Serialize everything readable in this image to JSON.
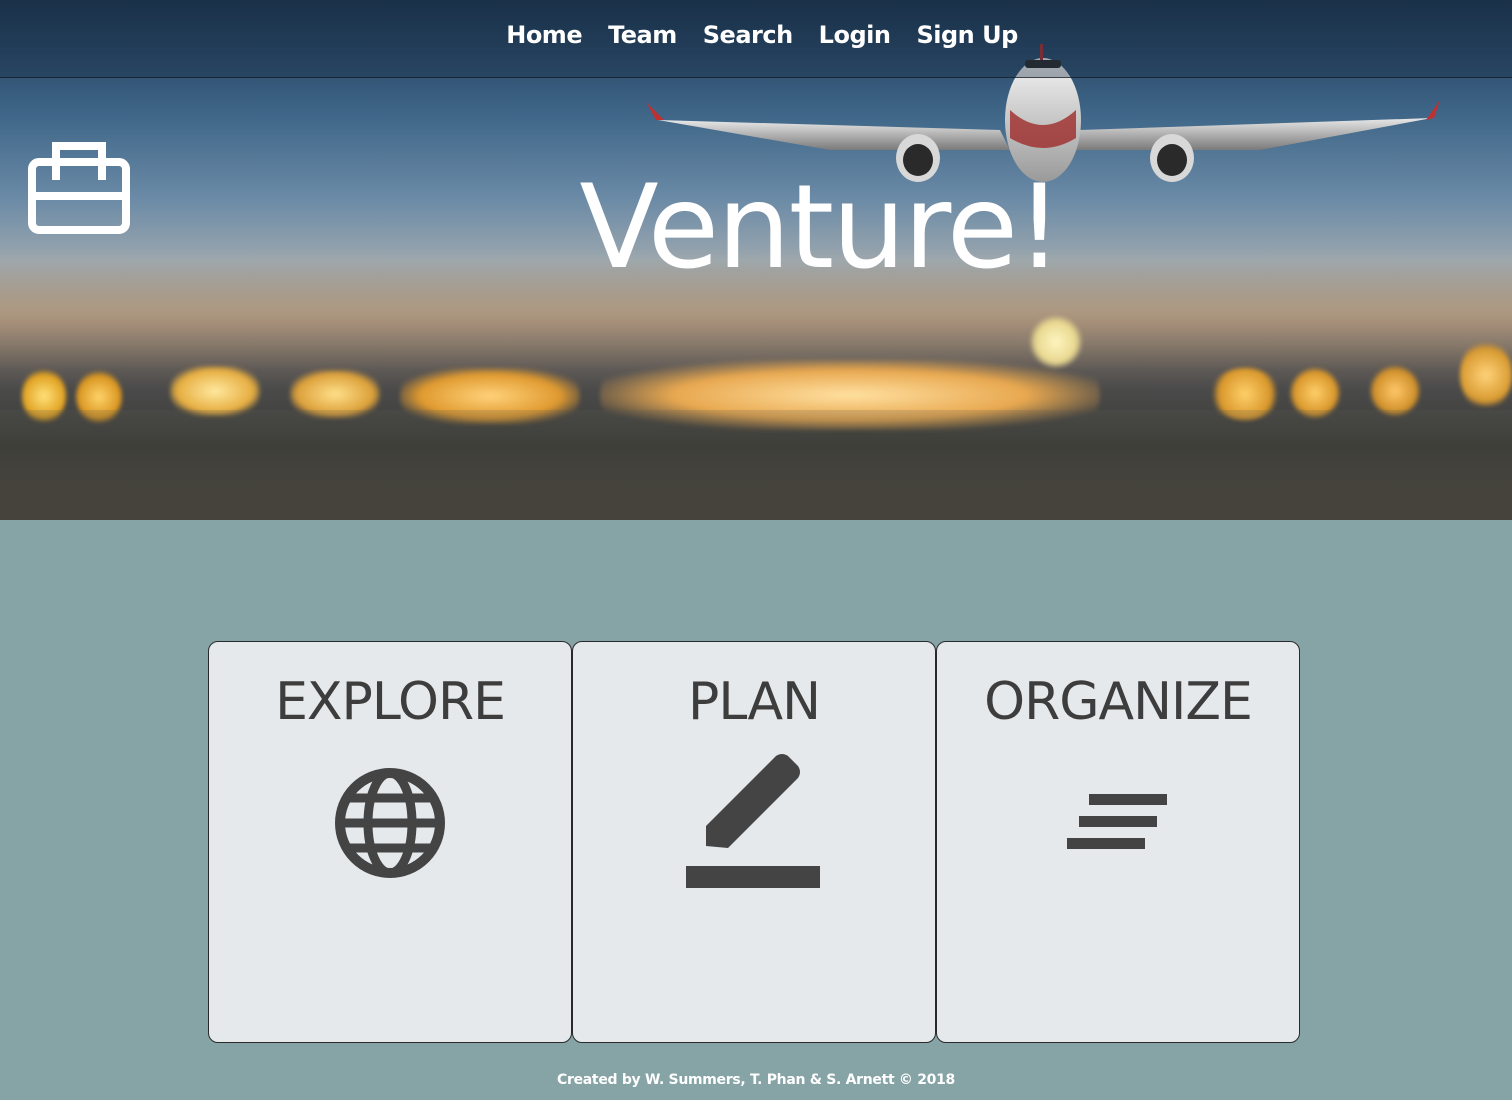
{
  "nav": {
    "items": [
      {
        "label": "Home"
      },
      {
        "label": "Team"
      },
      {
        "label": "Search"
      },
      {
        "label": "Login"
      },
      {
        "label": "Sign Up"
      }
    ]
  },
  "hero": {
    "title": "Venture!",
    "brand_icon": "briefcase-icon"
  },
  "cards": [
    {
      "title": "EXPLORE",
      "icon": "globe-icon"
    },
    {
      "title": "PLAN",
      "icon": "pencil-icon"
    },
    {
      "title": "ORGANIZE",
      "icon": "align-lines-icon"
    }
  ],
  "footer": {
    "credit": "Created by W. Summers, T. Phan & S. Arnett © 2018"
  },
  "colors": {
    "page_background": "#86a3a6",
    "card_background": "#e5e9eb",
    "card_text": "#3d3d3d",
    "nav_text": "#ffffff"
  }
}
